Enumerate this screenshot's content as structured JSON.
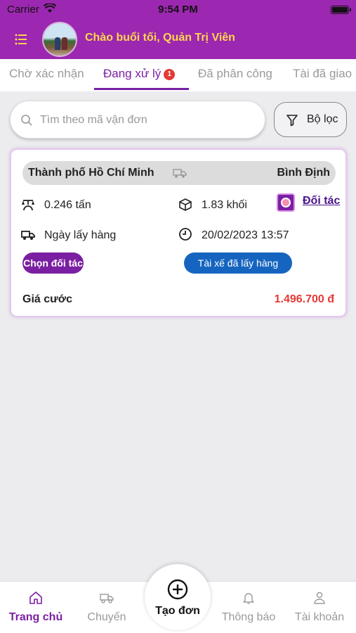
{
  "status_bar": {
    "carrier": "Carrier",
    "time": "9:54 PM"
  },
  "header": {
    "greeting": "Chào buổi tối, Quản Trị Viên"
  },
  "tabs": [
    {
      "label": "Chờ xác nhận",
      "active": false
    },
    {
      "label": "Đang xử lý",
      "active": true,
      "badge": "1"
    },
    {
      "label": "Đã phân công",
      "active": false
    },
    {
      "label": "Tài đã giao",
      "active": false
    }
  ],
  "search": {
    "placeholder": "Tìm theo mã vận đơn",
    "value": ""
  },
  "filter": {
    "label": "Bộ lọc"
  },
  "order": {
    "from": "Thành phố Hồ Chí Minh",
    "to": "Bình Định",
    "weight": "0.246 tấn",
    "volume": "1.83 khối",
    "partner_link": "Đối tác",
    "pickup_label": "Ngày lấy hàng",
    "pickup_time": "20/02/2023 13:57",
    "choose_partner_button": "Chọn đối tác",
    "driver_picked_button": "Tài xế đã lấy hàng",
    "price_label": "Giá cước",
    "price_value": "1.496.700 đ"
  },
  "bottom_nav": {
    "home": "Trang chủ",
    "trips": "Chuyến",
    "create": "Tạo đơn",
    "notifications": "Thông báo",
    "account": "Tài khoản"
  },
  "colors": {
    "primary": "#9c27b0",
    "accent_text": "#ffd54f",
    "price": "#e53935",
    "blue_button": "#1565c0"
  }
}
